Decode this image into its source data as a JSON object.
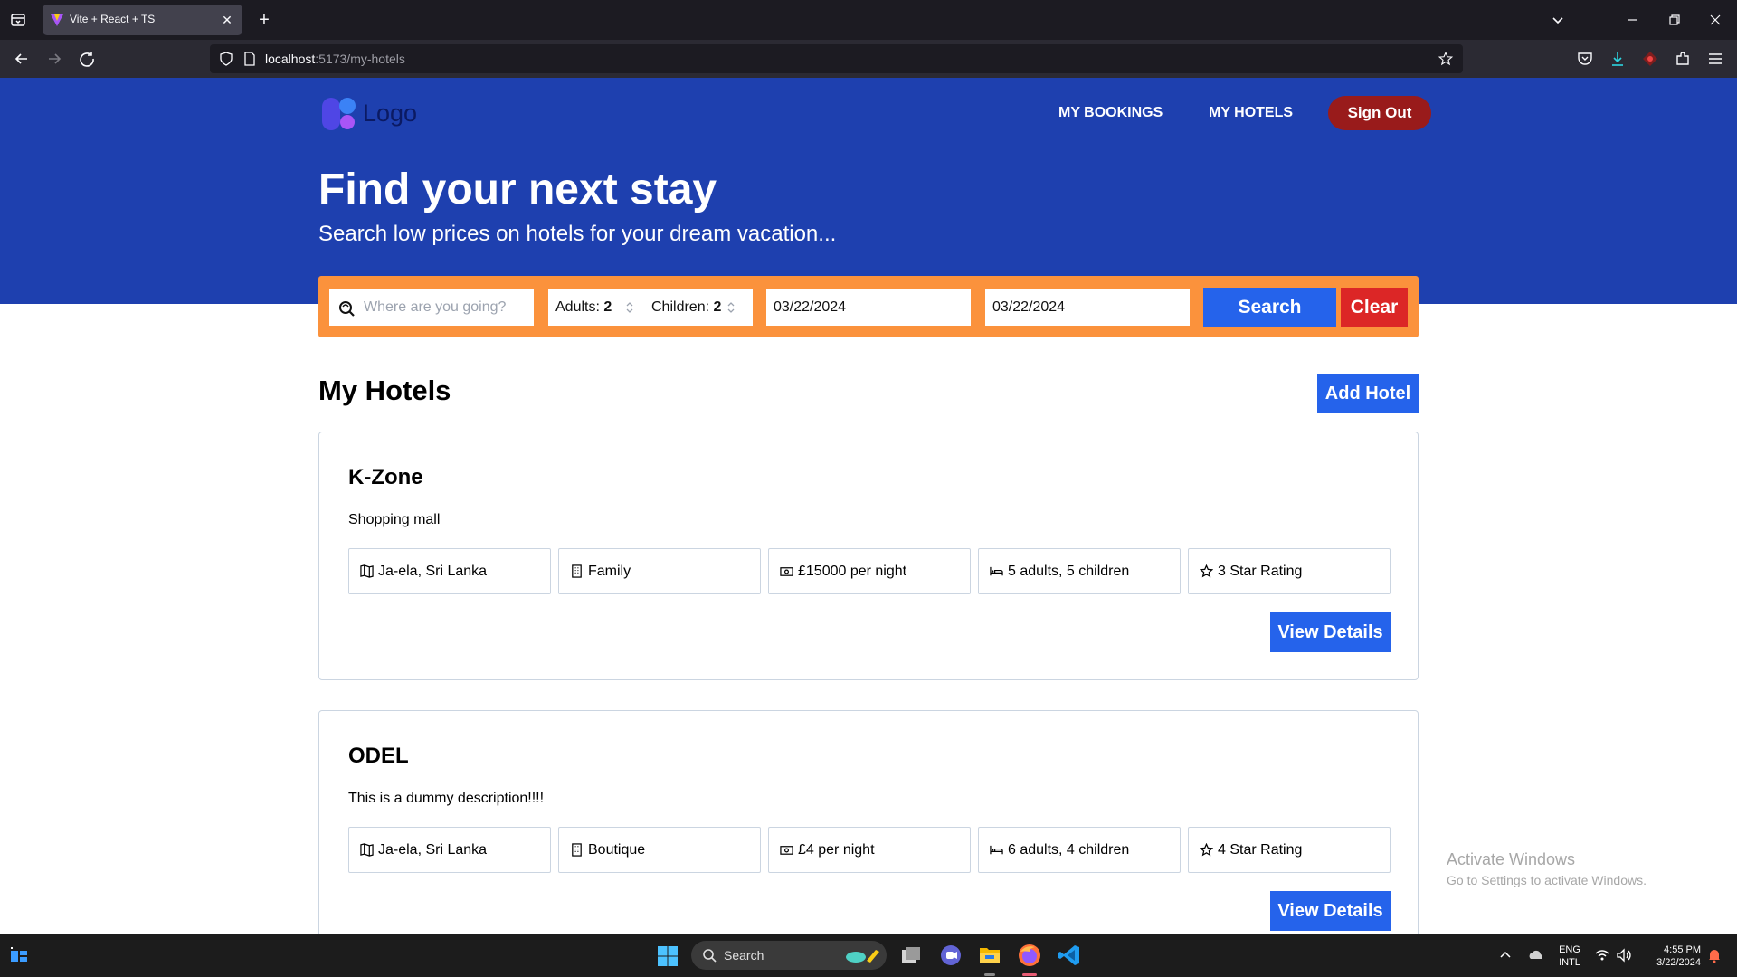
{
  "browser": {
    "tab_title": "Vite + React + TS",
    "url_host": "localhost",
    "url_path": ":5173/my-hotels"
  },
  "header": {
    "logo_text": "Logo",
    "nav": [
      "MY BOOKINGS",
      "MY HOTELS"
    ],
    "signout_label": "Sign Out"
  },
  "hero": {
    "title": "Find your next stay",
    "subtitle": "Search low prices on hotels for your dream vacation..."
  },
  "search": {
    "destination_placeholder": "Where are you going?",
    "adults_label": "Adults:",
    "adults_value": "2",
    "children_label": "Children:",
    "children_value": "2",
    "check_in": "03/22/2024",
    "check_out": "03/22/2024",
    "search_label": "Search",
    "clear_label": "Clear"
  },
  "page": {
    "title": "My Hotels",
    "add_hotel_label": "Add Hotel",
    "view_details_label": "View Details"
  },
  "hotels": [
    {
      "name": "K-Zone",
      "description": "Shopping mall",
      "location": "Ja-ela, Sri Lanka",
      "type": "Family",
      "price": "£15000 per night",
      "guests": "5 adults, 5 children",
      "rating": "3 Star Rating"
    },
    {
      "name": "ODEL",
      "description": "This is a dummy description!!!!",
      "location": "Ja-ela, Sri Lanka",
      "type": "Boutique",
      "price": "£4 per night",
      "guests": "6 adults, 4 children",
      "rating": "4 Star Rating"
    }
  ],
  "watermark": {
    "line1": "Activate Windows",
    "line2": "Go to Settings to activate Windows."
  },
  "taskbar": {
    "search_label": "Search",
    "lang_line1": "ENG",
    "lang_line2": "INTL",
    "time": "4:55 PM",
    "date": "3/22/2024"
  },
  "colors": {
    "hero_bg": "#1e40af",
    "search_bar_bg": "#fb923c",
    "primary_button": "#2563eb",
    "clear_button": "#dc2626",
    "signout_button": "#991b1b"
  }
}
